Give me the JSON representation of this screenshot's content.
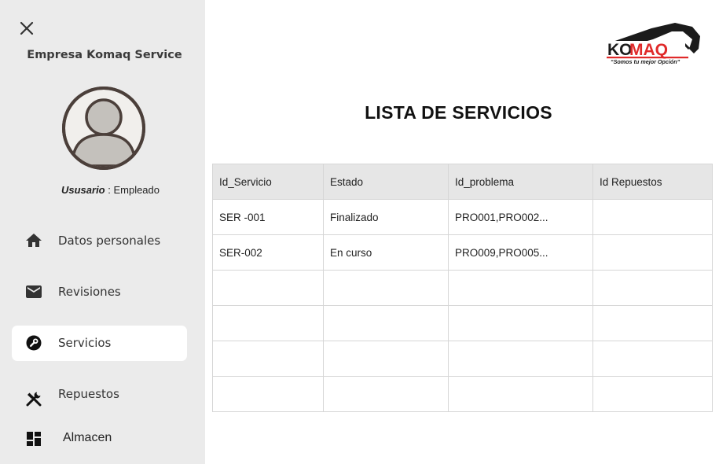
{
  "sidebar": {
    "company_name": "Empresa Komaq Service",
    "role_key": "Ususario",
    "role_value": " : Empleado",
    "items": [
      {
        "label": "Datos personales",
        "icon": "home-icon"
      },
      {
        "label": "Revisiones",
        "icon": "mail-icon"
      },
      {
        "label": "Servicios",
        "icon": "wrench-icon",
        "active": true
      },
      {
        "label": "Repuestos",
        "icon": "tools-icon"
      },
      {
        "label": "Almacen",
        "icon": "dashboard-icon"
      }
    ]
  },
  "logo": {
    "text_ko": "KO",
    "text_maq": "MAQ",
    "slogan": "“Somos tu mejor Opción”",
    "colors": {
      "dark": "#1b1b1b",
      "red": "#e02a2a"
    }
  },
  "main": {
    "title": "LISTA DE SERVICIOS",
    "table": {
      "headers": [
        "Id_Servicio",
        "Estado",
        "Id_problema",
        "Id Repuestos"
      ],
      "rows": [
        [
          "SER -001",
          "Finalizado",
          "PRO001,PRO002...",
          ""
        ],
        [
          "SER-002",
          "En curso",
          "PRO009,PRO005...",
          ""
        ],
        [
          "",
          "",
          "",
          ""
        ],
        [
          "",
          "",
          "",
          ""
        ],
        [
          "",
          "",
          "",
          ""
        ],
        [
          "",
          "",
          "",
          ""
        ]
      ]
    }
  },
  "colors": {
    "sidebar_bg": "#ebebeb",
    "active_item_bg": "#ffffff",
    "header_bg": "#e6e6e6"
  }
}
